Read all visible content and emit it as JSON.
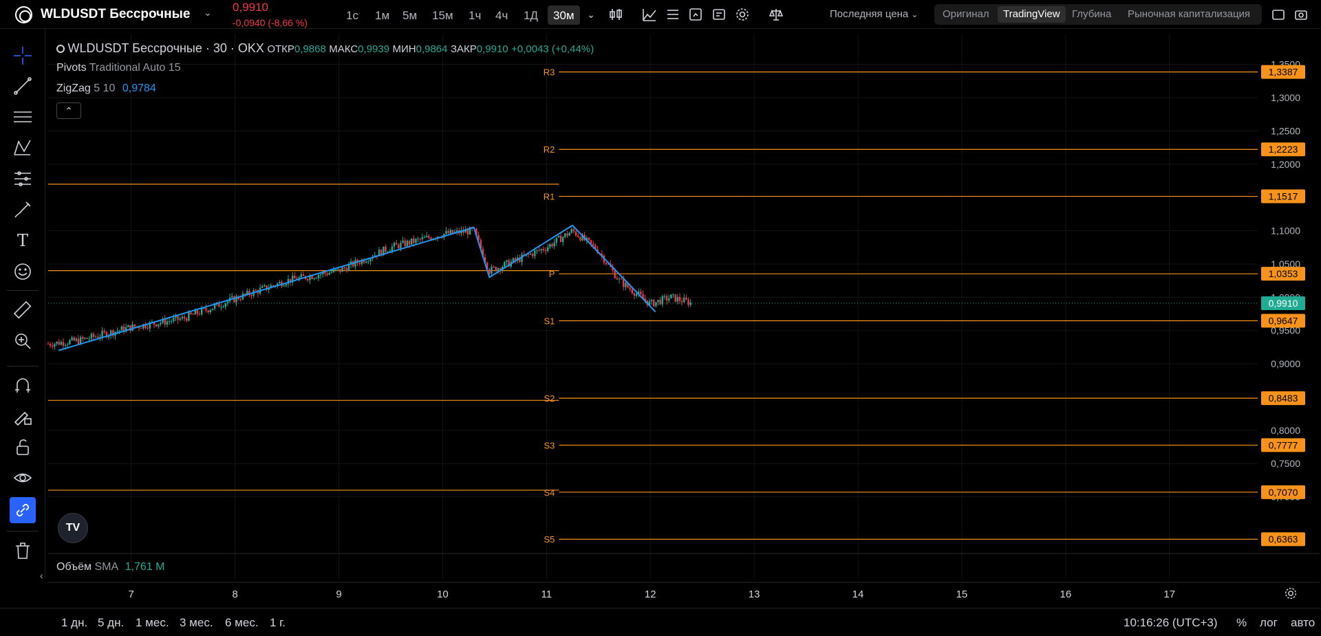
{
  "header": {
    "symbol": "WLDUSDT Бессрочные",
    "last_price": "0,9910",
    "change": "-0,0940 (-8,66 %)",
    "timeframes": [
      "1с",
      "1м",
      "5м",
      "15м",
      "1ч",
      "4ч",
      "1Д",
      "30м"
    ],
    "active_timeframe": "30м",
    "price_type": "Последняя цена",
    "view_modes": [
      "Оригинал",
      "TradingView",
      "Глубина",
      "Рыночная капитализация"
    ],
    "active_view": "TradingView"
  },
  "legend": {
    "title": "WLDUSDT Бессрочные · 30 · OKX",
    "open_label": "ОТКР",
    "open": "0,9868",
    "high_label": "МАКС",
    "high": "0,9939",
    "low_label": "МИН",
    "low": "0,9864",
    "close_label": "ЗАКР",
    "close": "0,9910",
    "delta": "+0,0043 (+0,44%)",
    "pivots_name": "Pivots",
    "pivots_params": "Traditional Auto 15",
    "zigzag_name": "ZigZag",
    "zigzag_params": "5 10",
    "zigzag_value": "0,9784",
    "volume_name": "Объём",
    "volume_sma": "SMA",
    "volume_value": "1,761 M"
  },
  "chart_data": {
    "type": "candlestick",
    "instrument": "WLDUSDT Бессрочные · 30 · OKX",
    "ylim": [
      0.62,
      1.36
    ],
    "y_ticks": [
      1.35,
      1.3,
      1.25,
      1.2,
      1.1,
      1.05,
      1.0,
      0.95,
      0.9,
      0.8,
      0.75,
      0.7
    ],
    "y_tick_labels": [
      "1,3500",
      "1,3000",
      "1,2500",
      "1,2000",
      "1,1000",
      "1,0500",
      "1,0000",
      "0,9500",
      "0,9000",
      "0,8000",
      "0,7500",
      "0,7000"
    ],
    "x_ticks": [
      7,
      8,
      9,
      10,
      11,
      12,
      13,
      14,
      15,
      16,
      17
    ],
    "xlim": [
      6.2,
      17.85
    ],
    "last_price": 0.991,
    "pivot_levels_current": [
      {
        "name": "R3",
        "value": 1.3387,
        "label": "1,3387"
      },
      {
        "name": "R2",
        "value": 1.2223,
        "label": "1,2223"
      },
      {
        "name": "R1",
        "value": 1.1517,
        "label": "1,1517"
      },
      {
        "name": "P",
        "value": 1.0353,
        "label": "1,0353"
      },
      {
        "name": "S1",
        "value": 0.9647,
        "label": "0,9647"
      },
      {
        "name": "S2",
        "value": 0.8483,
        "label": "0,8483"
      },
      {
        "name": "S3",
        "value": 0.7777,
        "label": "0,7777"
      },
      {
        "name": "S4",
        "value": 0.707,
        "label": "0,7070"
      },
      {
        "name": "S5",
        "value": 0.6363,
        "label": "0,6363"
      }
    ],
    "pivot_levels_previous": [
      1.17,
      1.04,
      0.845,
      0.71
    ],
    "zigzag": [
      [
        6.3,
        0.92
      ],
      [
        10.3,
        1.105
      ],
      [
        10.45,
        1.03
      ],
      [
        11.25,
        1.108
      ],
      [
        12.05,
        0.978
      ]
    ],
    "price_path": [
      [
        6.2,
        0.93
      ],
      [
        6.5,
        0.935
      ],
      [
        7.0,
        0.955
      ],
      [
        7.5,
        0.968
      ],
      [
        8.0,
        0.998
      ],
      [
        8.5,
        1.025
      ],
      [
        9.0,
        1.04
      ],
      [
        9.5,
        1.075
      ],
      [
        10.0,
        1.095
      ],
      [
        10.3,
        1.1
      ],
      [
        10.45,
        1.04
      ],
      [
        10.7,
        1.055
      ],
      [
        11.0,
        1.075
      ],
      [
        11.25,
        1.1
      ],
      [
        11.5,
        1.07
      ],
      [
        11.7,
        1.025
      ],
      [
        12.0,
        0.99
      ],
      [
        12.2,
        1.0
      ],
      [
        12.4,
        0.991
      ]
    ]
  },
  "volume_axis_label": "0,6363",
  "bottom": {
    "ranges": [
      "1 дн.",
      "5 дн.",
      "1 мес.",
      "3 мес.",
      "6 мес.",
      "1 г."
    ],
    "clock": "10:16:26 (UTC+3)",
    "percent": "%",
    "log": "лог",
    "auto": "авто"
  },
  "colors": {
    "up": "#22ab94",
    "down": "#f23645",
    "pivot": "#f7931a",
    "zigzag": "#2196f3",
    "accent": "#2962ff",
    "background": "#000000"
  }
}
